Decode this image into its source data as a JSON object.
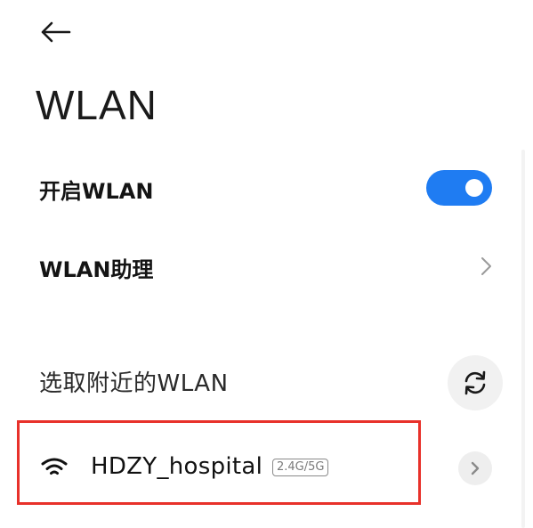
{
  "header": {
    "back_icon": "arrow-left-icon",
    "title": "WLAN"
  },
  "settings": {
    "wlan_toggle": {
      "label": "开启WLAN",
      "enabled": true,
      "accent_color": "#1f7cf2"
    },
    "wlan_assistant": {
      "label": "WLAN助理",
      "icon": "chevron-right-icon"
    }
  },
  "nearby": {
    "header": "选取附近的WLAN",
    "refresh_icon": "refresh-icon",
    "networks": [
      {
        "ssid": "HDZY_hospital",
        "band": "2.4G/5G",
        "icon": "wifi-icon",
        "detail_icon": "chevron-right-icon"
      }
    ]
  },
  "annotation": {
    "highlight_color": "#e8312a"
  }
}
